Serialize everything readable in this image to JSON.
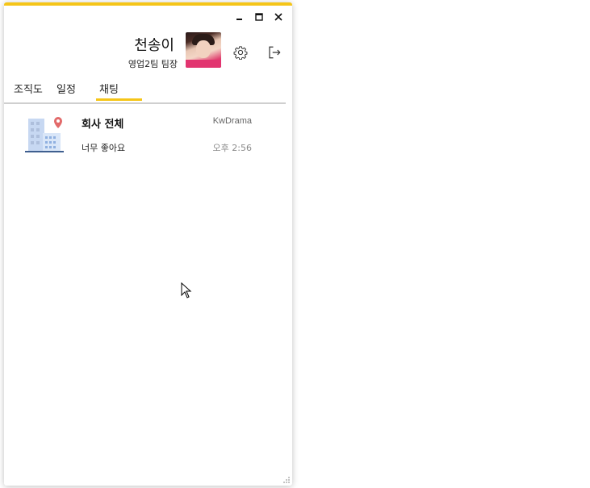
{
  "window": {
    "controls": {
      "minimize_icon": "minimize-icon",
      "maximize_icon": "maximize-icon",
      "close_icon": "close-icon"
    },
    "accent_color": "#f5c518"
  },
  "profile": {
    "name": "천송이",
    "title": "영업2팀 팀장",
    "settings_icon": "gear-icon",
    "logout_icon": "logout-icon"
  },
  "tabs": [
    {
      "label": "조직도"
    },
    {
      "label": "일정"
    },
    {
      "label": "채팅",
      "active": true
    }
  ],
  "chat_rooms": [
    {
      "name": "회사 전체",
      "last_sender": "KwDrama",
      "last_message": "너무 좋아요",
      "time": "오후 2:56",
      "icon": "building-location-icon"
    }
  ]
}
